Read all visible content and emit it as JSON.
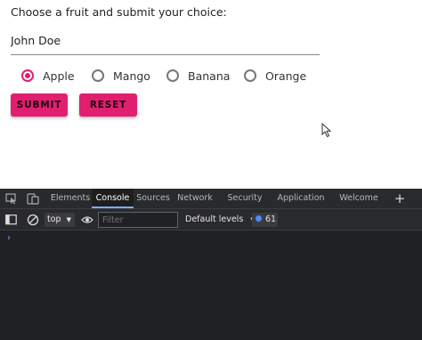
{
  "form": {
    "prompt": "Choose a fruit and submit your choice:",
    "name_value": "John Doe",
    "options": [
      {
        "label": "Apple",
        "checked": true
      },
      {
        "label": "Mango",
        "checked": false
      },
      {
        "label": "Banana",
        "checked": false
      },
      {
        "label": "Orange",
        "checked": false
      }
    ],
    "submit_label": "SUBMIT",
    "reset_label": "RESET",
    "accent_color": "#e0206f"
  },
  "devtools": {
    "tabs": [
      {
        "label": "Elements",
        "active": false
      },
      {
        "label": "Console",
        "active": true
      },
      {
        "label": "Sources",
        "active": false
      },
      {
        "label": "Network",
        "active": false
      },
      {
        "label": "Security",
        "active": false
      },
      {
        "label": "Application",
        "active": false
      },
      {
        "label": "Welcome",
        "active": false
      }
    ],
    "add_tab_label": "+",
    "context": "top",
    "filter_placeholder": "Filter",
    "levels_label": "Default levels",
    "message_count": "61",
    "prompt_caret": "›"
  }
}
